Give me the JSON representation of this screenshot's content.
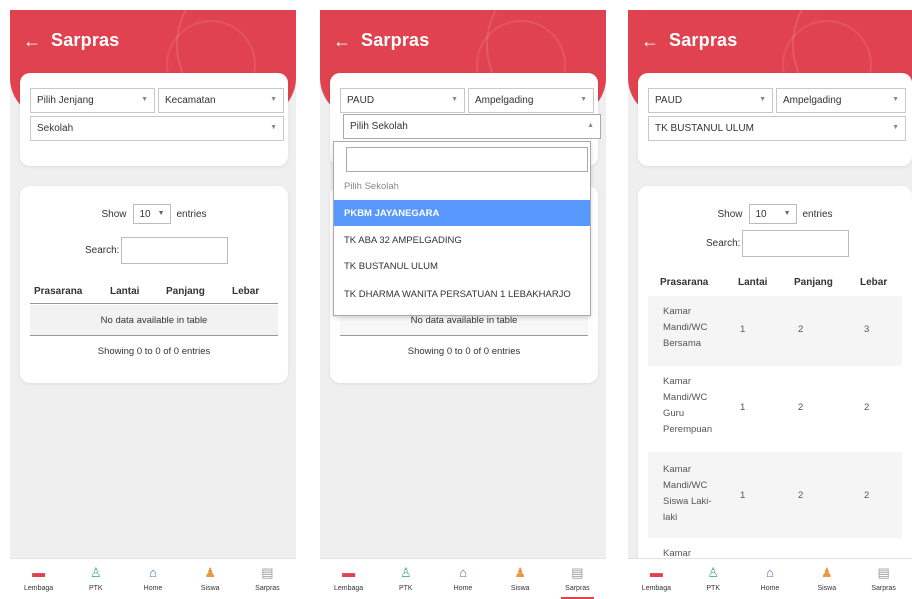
{
  "app": {
    "title": "Sarpras",
    "back_icon": "arrow-left-icon"
  },
  "screen1": {
    "jenjang_value": "Pilih Jenjang",
    "kecamatan_value": "Kecamatan",
    "sekolah_value": "Sekolah",
    "show_label": "Show",
    "entries_value": "10",
    "entries_label": "entries",
    "search_label": "Search:",
    "columns": [
      "Prasarana",
      "Lantai",
      "Panjang",
      "Lebar"
    ],
    "empty_text": "No data available in table",
    "info_text": "Showing 0 to 0 of 0 entries"
  },
  "screen2": {
    "jenjang_value": "PAUD",
    "kecamatan_value": "Ampelgading",
    "sekolah_value": "Pilih Sekolah",
    "dropdown_options": [
      "Pilih Sekolah",
      "PKBM JAYANEGARA",
      "TK ABA 32 AMPELGADING",
      "TK BUSTANUL ULUM",
      "TK DHARMA WANITA PERSATUAN 1 LEBAKHARJO"
    ],
    "highlighted_option": "PKBM JAYANEGARA",
    "empty_text": "No data available in table",
    "info_text": "Showing 0 to 0 of 0 entries"
  },
  "screen3": {
    "jenjang_value": "PAUD",
    "kecamatan_value": "Ampelgading",
    "sekolah_value": "TK BUSTANUL ULUM",
    "show_label": "Show",
    "entries_value": "10",
    "entries_label": "entries",
    "search_label": "Search:",
    "columns": [
      "Prasarana",
      "Lantai",
      "Panjang",
      "Lebar"
    ],
    "rows": [
      {
        "prasarana": "Kamar Mandi/WC Bersama",
        "lantai": "1",
        "panjang": "2",
        "lebar": "3"
      },
      {
        "prasarana": "Kamar Mandi/WC Guru Perempuan",
        "lantai": "1",
        "panjang": "2",
        "lebar": "2"
      },
      {
        "prasarana": "Kamar Mandi/WC Siswa Laki-laki",
        "lantai": "1",
        "panjang": "2",
        "lebar": "2"
      },
      {
        "prasarana": "Kamar",
        "lantai": "",
        "panjang": "",
        "lebar": ""
      }
    ]
  },
  "nav": {
    "items": [
      {
        "label": "Lembaga",
        "icon": "building-icon"
      },
      {
        "label": "PTK",
        "icon": "person-icon"
      },
      {
        "label": "Home",
        "icon": "home-icon"
      },
      {
        "label": "Siswa",
        "icon": "users-icon"
      },
      {
        "label": "Sarpras",
        "icon": "inventory-icon"
      }
    ],
    "active": "Sarpras"
  },
  "colors": {
    "brand_red": "#e0424f",
    "highlight_blue": "#5897fb",
    "background": "#efefef"
  }
}
